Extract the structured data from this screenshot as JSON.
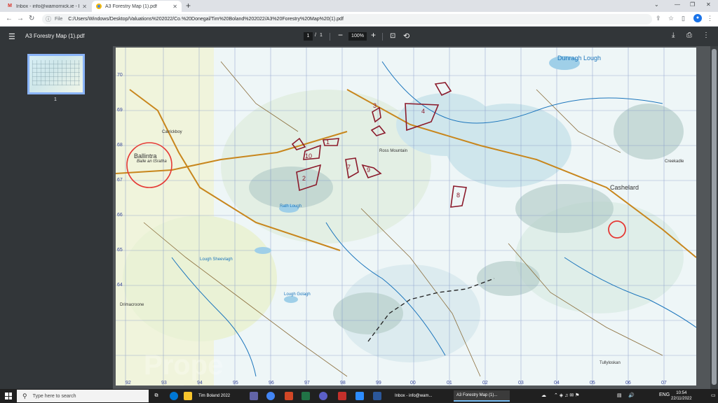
{
  "browser": {
    "tabs": [
      {
        "title": "Inbox - info@wamornick.ie - P",
        "icon": "gmail-icon"
      },
      {
        "title": "A3 Forestry Map (1).pdf",
        "icon": "pdf-globe-icon"
      }
    ],
    "address": {
      "scheme": "File",
      "url": "C:/Users/Windows/Desktop/Valuations%202022/Co.%20Donegal/Tim%20Boland%202022/A3%20Forestry%20Map%20(1).pdf"
    }
  },
  "pdf_toolbar": {
    "title": "A3 Forestry Map (1).pdf",
    "page_current": "1",
    "page_separator": "/",
    "page_total": "1",
    "zoom": "100%"
  },
  "sidebar": {
    "thumbnail_page_number": "1"
  },
  "map": {
    "watermark": "Prope\nPal.c",
    "labels": {
      "ballintra_en": "Ballintra",
      "ballintra_ga": "Baile an tSratha",
      "dunragh_lough": "Dunragh Lough",
      "cashelard": "Cashelard",
      "creekadle": "Creekadle",
      "ross_mountain": "Ross Mountain",
      "lough_golagh": "Lough Golagh",
      "tullyloskan": "Tullyloskan",
      "carrickboy": "Carrickboy",
      "lough_sheevlagh": "Lough Sheevlagh",
      "rath_lough": "Rath Lough",
      "drimacroone": "Drimacroone"
    },
    "parcel_numbers": [
      "1",
      "2",
      "3",
      "4",
      "7",
      "8",
      "9",
      "10"
    ],
    "grid_eastings": [
      "92",
      "93",
      "94",
      "95",
      "96",
      "97",
      "98",
      "99",
      "00",
      "01",
      "02",
      "03",
      "04",
      "05",
      "06",
      "07"
    ],
    "grid_northings": [
      "70",
      "69",
      "68",
      "67",
      "66",
      "65",
      "64"
    ],
    "circle_markers": [
      "ballintra-circle",
      "east-circle"
    ]
  },
  "taskbar": {
    "search_placeholder": "Type here to search",
    "apps": [
      {
        "label": "Tim Boland 2022"
      },
      {
        "label": "Inbox - info@wam..."
      },
      {
        "label": "A3 Forestry Map (1)..."
      }
    ],
    "tray_lang": "ENG",
    "time": "10:54",
    "date": "22/11/2022"
  },
  "colors": {
    "parcel_outline": "#8b1a2b",
    "circle_marker": "#e53935",
    "road": "#c8861c",
    "water": "#1b75bc",
    "grid": "#7a8fc4"
  }
}
